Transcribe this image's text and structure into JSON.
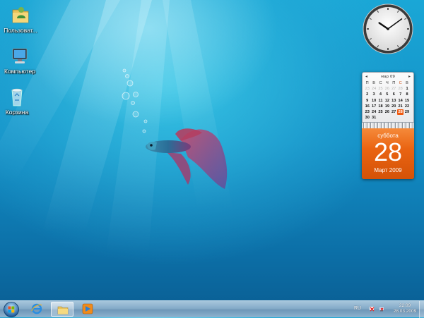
{
  "desktop": {
    "icons": [
      {
        "label": "Пользоват...",
        "icon": "user-folder-icon"
      },
      {
        "label": "Компьютер",
        "icon": "computer-icon"
      },
      {
        "label": "Корзина",
        "icon": "recycle-bin-icon"
      }
    ]
  },
  "clock": {
    "hour": 10,
    "minute": 9
  },
  "calendar": {
    "month_label": "мар 09",
    "prev": "◂",
    "next": "▸",
    "weekdays": [
      "П",
      "В",
      "С",
      "Ч",
      "П",
      "С",
      "В"
    ],
    "weeks": [
      [
        "23",
        "24",
        "25",
        "26",
        "27",
        "28",
        "1"
      ],
      [
        "2",
        "3",
        "4",
        "5",
        "6",
        "7",
        "8"
      ],
      [
        "9",
        "10",
        "11",
        "12",
        "13",
        "14",
        "15"
      ],
      [
        "16",
        "17",
        "18",
        "19",
        "20",
        "21",
        "22"
      ],
      [
        "23",
        "24",
        "25",
        "26",
        "27",
        "28",
        "29"
      ],
      [
        "30",
        "31",
        "",
        "",
        "",
        "",
        ""
      ]
    ],
    "today": "28",
    "day_name": "суббота",
    "day_number": "28",
    "month_year": "Март 2009"
  },
  "taskbar": {
    "items": [
      {
        "name": "internet-explorer-icon"
      },
      {
        "name": "explorer-folder-icon",
        "active": true
      },
      {
        "name": "media-player-icon"
      }
    ],
    "language": "RU",
    "time": "22:09",
    "date": "28.03.2009"
  }
}
